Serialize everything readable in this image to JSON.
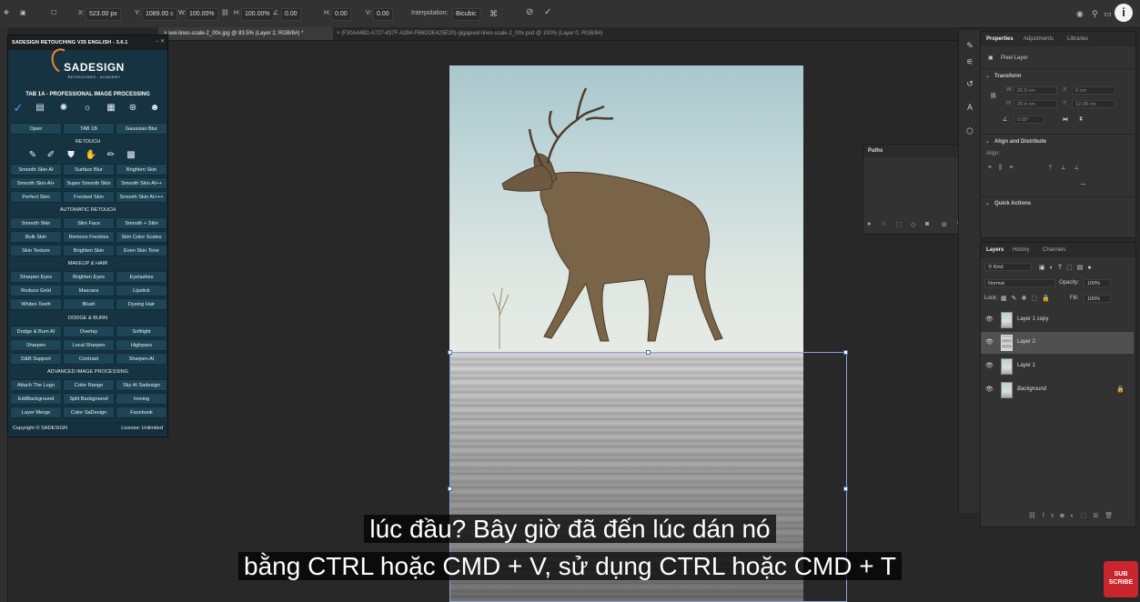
{
  "options_bar": {
    "x_label": "X:",
    "x_value": "523.00 px",
    "y_label": "Y:",
    "y_value": "1089.00 c",
    "w_label": "W:",
    "w_value": "100.00%",
    "h_label": "H:",
    "h_value": "100.00%",
    "angle_value": "0.00",
    "hskew_label": "H:",
    "hskew_value": "0.00",
    "vskew_label": "V:",
    "vskew_value": "0.00",
    "interp_label": "Interpolation:",
    "interp_value": "Bicubic"
  },
  "tabs": [
    {
      "label": "ixel-lines-scale-2_00x.jpg @ 83.5% (Layer 2, RGB/8#) *"
    },
    {
      "label": "(F30A44B2-A727-437F-A394-FB6DDE425E20)-gigapixel-lines-scale-2_00x.psd @ 100% (Layer 0, RGB/8#)"
    }
  ],
  "sadesign": {
    "header": "SADESIGN RETOUCHING V35 ENGLISH - 3.6.1",
    "logo": "SADESIGN",
    "logo_sub": "RETOUCHING - ACADEMY",
    "tab_title": "TAB 1A - PROFESSIONAL IMAGE PROCESSING",
    "top_buttons": [
      "Open",
      "TAB 1B",
      "Gaussian Blur"
    ],
    "retouch_title": "RETOUCH",
    "retouch_buttons": [
      "Smooth Skin AI",
      "Surface Blur",
      "Brighten Skin",
      "Smooth Skin AI+",
      "Super Smooth Skin",
      "Smooth Skin AI++",
      "Perfect Skin",
      "Frecked Skin",
      "Smooth Skin AI+++"
    ],
    "auto_title": "AUTOMATIC RETOUCH",
    "auto_buttons": [
      "Smooth Skin",
      "Slim Face",
      "Smooth + Slim",
      "Bulk Skin",
      "Remove Freckles",
      "Skin Color Scales",
      "Skin Texture",
      "Brighten Skin",
      "Even Skin Tone"
    ],
    "makeup_title": "MAKEUP & HAIR",
    "makeup_buttons": [
      "Sharpen Eyes",
      "Brighten Eyes",
      "Eyelashes",
      "Reduce Gold",
      "Mascara",
      "Lipstick",
      "Whiten Teeth",
      "Blush",
      "Dyeing Hair"
    ],
    "dodge_title": "DODGE & BURN",
    "dodge_buttons": [
      "Dodge & Burn AI",
      "Overlay",
      "Softlight",
      "Sharpen",
      "Local Sharpen",
      "Highpass",
      "D&B Support",
      "Contrast",
      "Sharpen AI"
    ],
    "adv_title": "ADVANCED IMAGE PROCESSING",
    "adv_buttons": [
      "Attach The Logo",
      "Color Range",
      "Sky AI Sadesign",
      "EditBackground",
      "Split Background",
      "Ironing",
      "Layer Merge",
      "Color SaDesign",
      "Facebook"
    ],
    "copyright": "Copyright © SADESIGN",
    "license": "License: Unlimited"
  },
  "paths_panel": {
    "title": "Paths"
  },
  "properties": {
    "tabs": [
      "Properties",
      "Adjustments",
      "Libraries"
    ],
    "pixel_layer": "Pixel Layer",
    "transform": "Transform",
    "w_label": "W:",
    "w_value": "26.9 cm",
    "x_label": "X:",
    "x_value": "0 cm",
    "h_label": "H:",
    "h_value": "20.4 cm",
    "y_label": "Y:",
    "y_value": "12.08 cm",
    "angle_value": "0.00°",
    "align_title": "Align and Distribute",
    "align_label": "Align:",
    "more": "...",
    "quick_actions": "Quick Actions"
  },
  "layers_panel": {
    "tabs": [
      "Layers",
      "History",
      "Channels"
    ],
    "kind": "Kind",
    "blend_mode": "Normal",
    "opacity_label": "Opacity:",
    "opacity_value": "100%",
    "lock_label": "Lock:",
    "fill_label": "Fill:",
    "fill_value": "100%",
    "layers": [
      {
        "name": "Layer 1 copy"
      },
      {
        "name": "Layer 2"
      },
      {
        "name": "Layer 1"
      },
      {
        "name": "Background"
      }
    ]
  },
  "subtitles": {
    "line1": "lúc đầu?  Bây giờ đã đến lúc dán nó",
    "line2": "bằng CTRL hoặc CMD + V, sử dụng CTRL hoặc CMD + T"
  },
  "subscribe": {
    "line1": "SUB",
    "line2": "SCRIBE"
  },
  "info": "i"
}
